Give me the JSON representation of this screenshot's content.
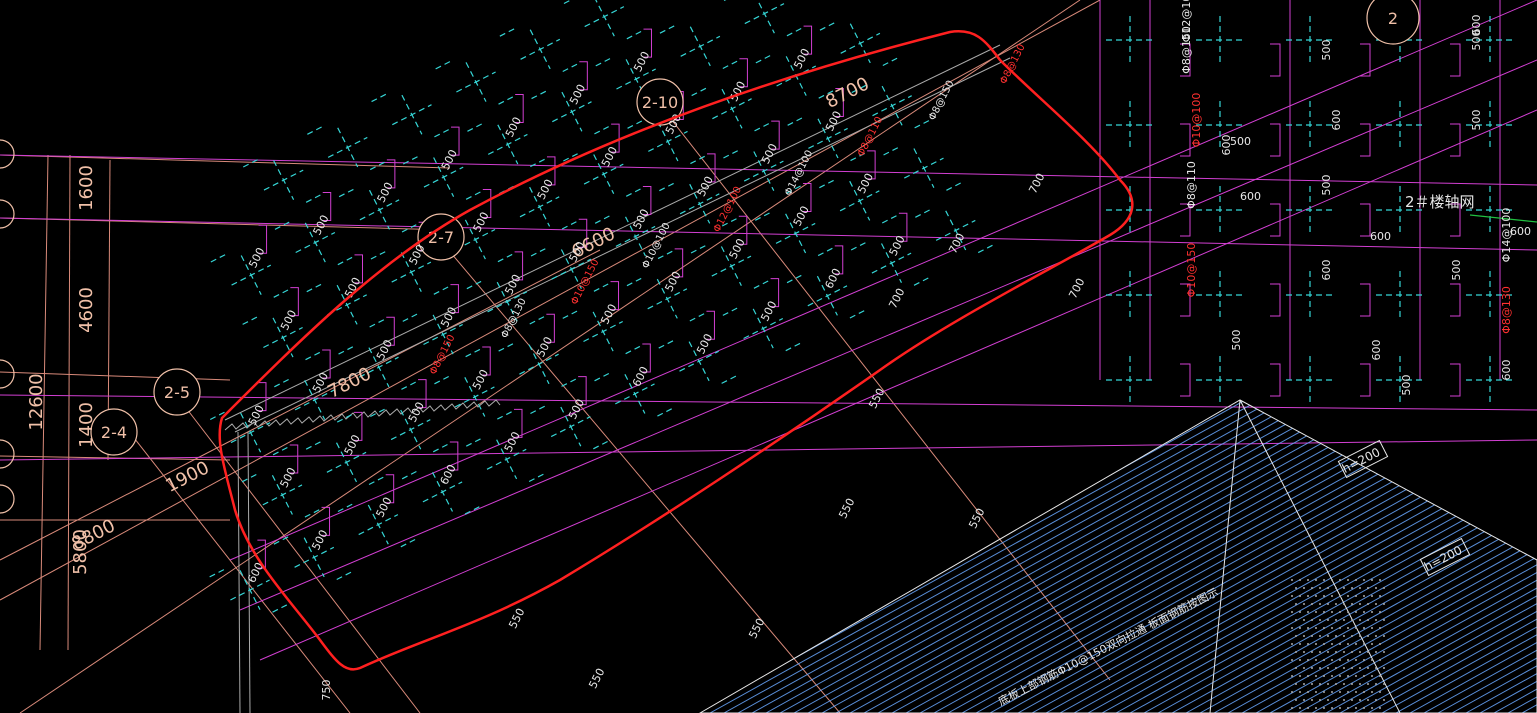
{
  "drawing": {
    "background": "#000000",
    "colors": {
      "axis_grid": "#d98a7a",
      "dimension": "#f0c0a8",
      "magenta": "#d23fd2",
      "cyan": "#35d6d6",
      "white": "#e8e8e8",
      "red_highlight": "#ff2020",
      "red_text": "#ff3030",
      "hatch": "#6aa8ff",
      "green": "#20c040"
    },
    "axis_bubbles": [
      {
        "id": "bubble-2-10",
        "label": "2-10"
      },
      {
        "id": "bubble-2-7",
        "label": "2-7"
      },
      {
        "id": "bubble-2-5",
        "label": "2-5"
      },
      {
        "id": "bubble-2-4",
        "label": "2-4"
      },
      {
        "id": "bubble-top-right",
        "label": "2"
      }
    ],
    "dimensions": {
      "d8700": "8700",
      "d6600": "6600",
      "d7800": "7800",
      "d1900": "1900",
      "d1600": "1600",
      "d4600": "4600",
      "d1400": "1400",
      "d12600": "12600",
      "d5800": "5800",
      "d8800": "8800"
    },
    "building_label": "2＃楼轴网",
    "labels_500": "500",
    "labels_600": "600",
    "labels_700": "700",
    "labels_550": "550",
    "labels_750": "750",
    "h200": "h=200",
    "rebar": {
      "r8_150": "Φ8@150",
      "r8_130": "Φ8@130",
      "r10_150": "Φ10@150",
      "r10_100": "Φ10@100",
      "r12_100": "Φ12@100",
      "r14_100": "Φ14@100",
      "r8_110": "Φ8@110"
    },
    "bottom_note": "底板上部钢筋Φ10@150双向拉通 板面钢筋按图示"
  }
}
